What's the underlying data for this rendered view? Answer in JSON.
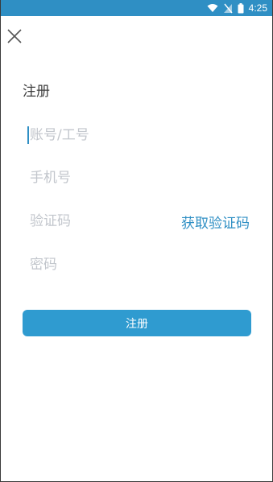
{
  "status_bar": {
    "time": "4:25",
    "icons": [
      "wifi-icon",
      "signal-icon",
      "battery-icon"
    ]
  },
  "header": {
    "close_icon": "close-icon"
  },
  "page": {
    "title": "注册"
  },
  "form": {
    "account_placeholder": "账号/工号",
    "phone_placeholder": "手机号",
    "code_placeholder": "验证码",
    "get_code_label": "获取验证码",
    "password_placeholder": "密码",
    "submit_label": "注册"
  },
  "colors": {
    "accent": "#2f8fc4",
    "button": "#2f9bd0",
    "placeholder": "#c2c6cc",
    "title": "#3c3c3c"
  }
}
